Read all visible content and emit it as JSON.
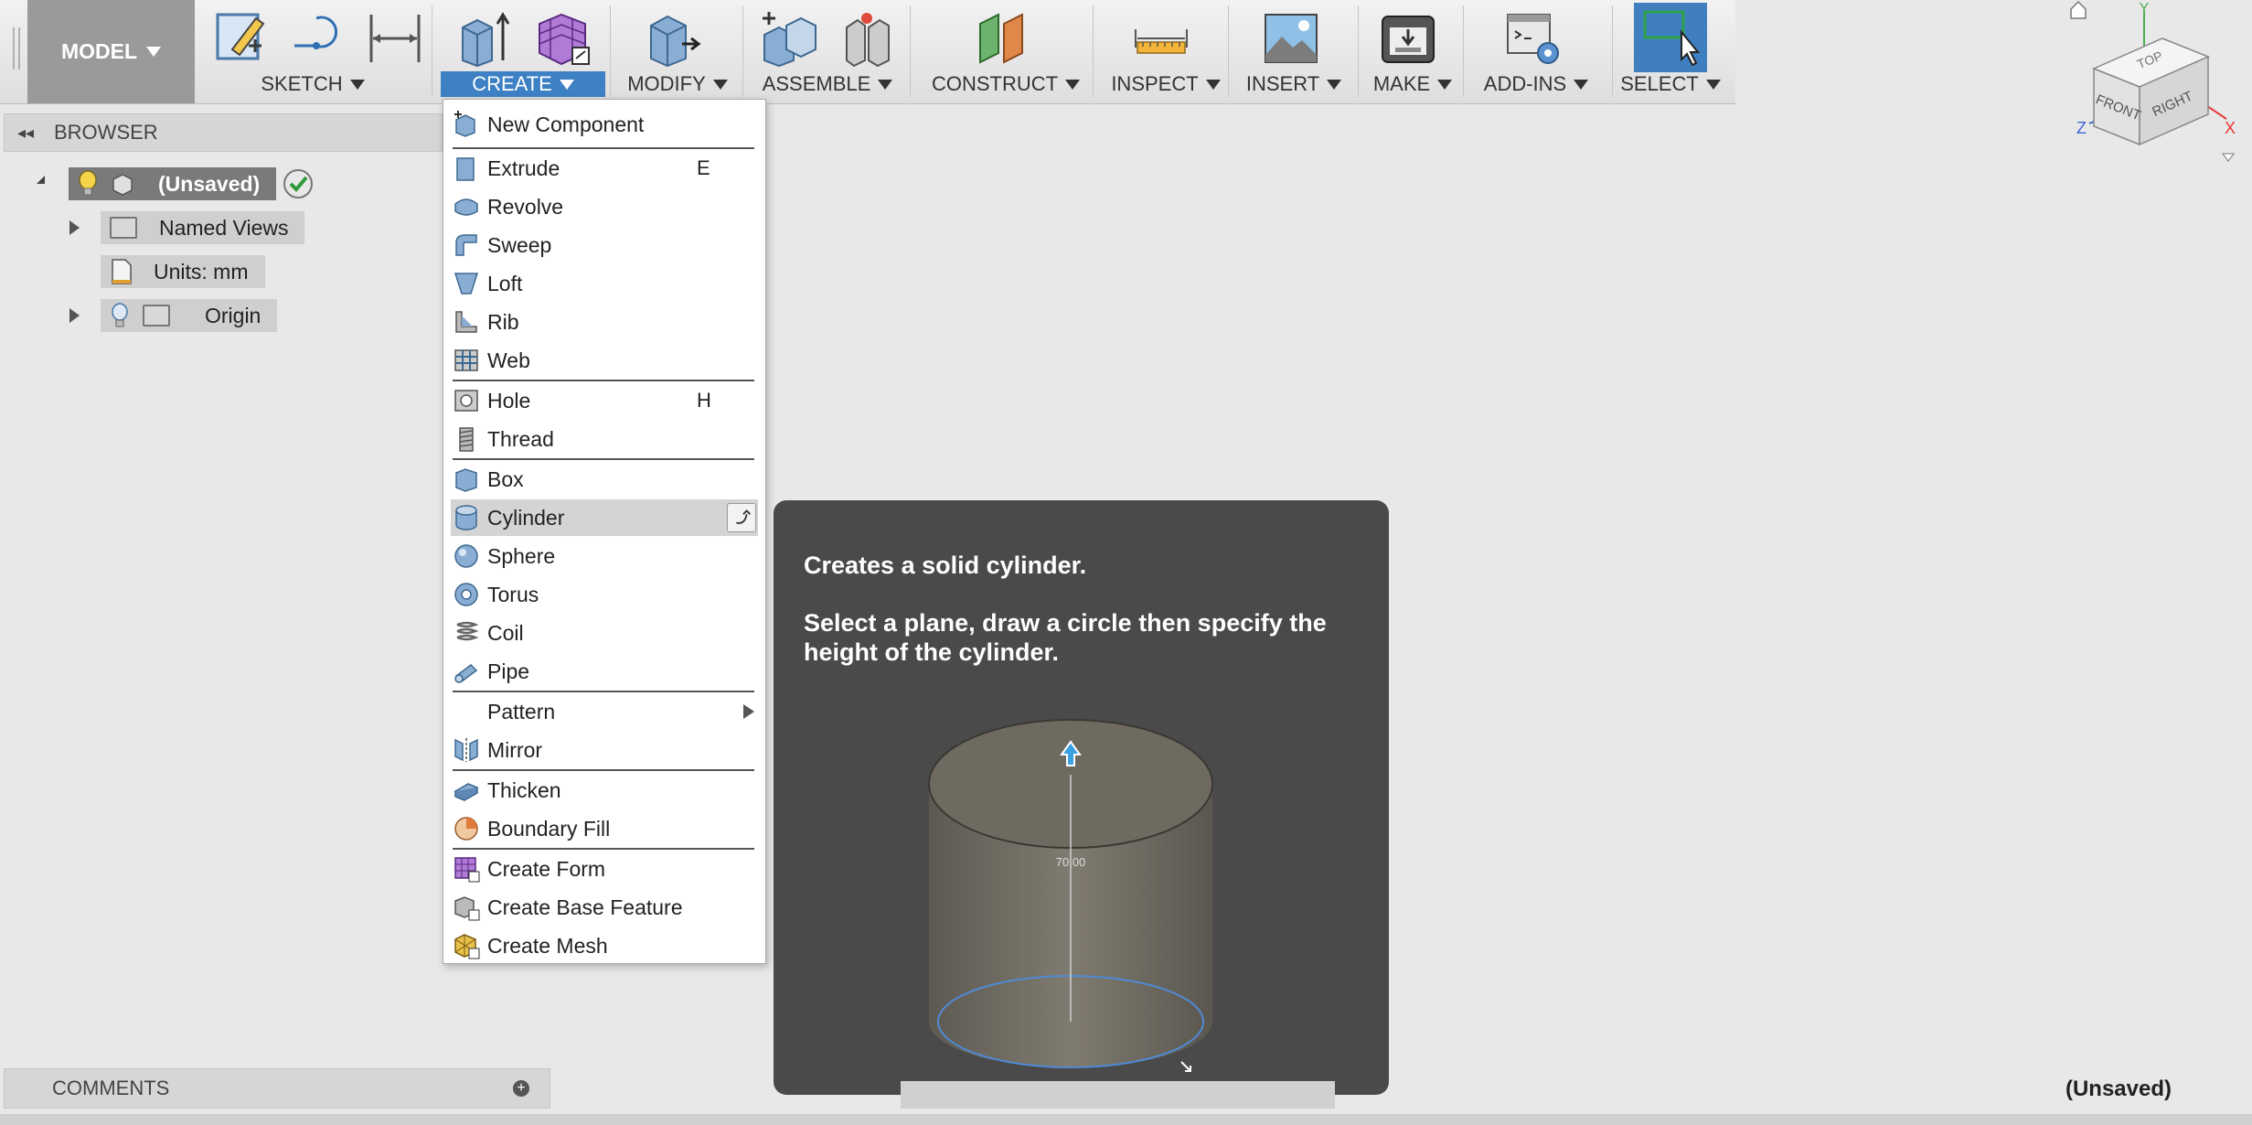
{
  "toolbar": {
    "workspace": "MODEL",
    "groups": [
      {
        "label": "SKETCH"
      },
      {
        "label": "CREATE"
      },
      {
        "label": "MODIFY"
      },
      {
        "label": "ASSEMBLE"
      },
      {
        "label": "CONSTRUCT"
      },
      {
        "label": "INSPECT"
      },
      {
        "label": "INSERT"
      },
      {
        "label": "MAKE"
      },
      {
        "label": "ADD-INS"
      },
      {
        "label": "SELECT"
      }
    ]
  },
  "browser": {
    "title": "BROWSER",
    "root": "(Unsaved)",
    "items": [
      "Named Views",
      "Units: mm",
      "Origin"
    ]
  },
  "create_menu": {
    "items": [
      {
        "label": "New Component",
        "shortcut": ""
      },
      {
        "label": "Extrude",
        "shortcut": "E"
      },
      {
        "label": "Revolve",
        "shortcut": ""
      },
      {
        "label": "Sweep",
        "shortcut": ""
      },
      {
        "label": "Loft",
        "shortcut": ""
      },
      {
        "label": "Rib",
        "shortcut": ""
      },
      {
        "label": "Web",
        "shortcut": ""
      },
      {
        "label": "Hole",
        "shortcut": "H"
      },
      {
        "label": "Thread",
        "shortcut": ""
      },
      {
        "label": "Box",
        "shortcut": ""
      },
      {
        "label": "Cylinder",
        "shortcut": ""
      },
      {
        "label": "Sphere",
        "shortcut": ""
      },
      {
        "label": "Torus",
        "shortcut": ""
      },
      {
        "label": "Coil",
        "shortcut": ""
      },
      {
        "label": "Pipe",
        "shortcut": ""
      },
      {
        "label": "Pattern",
        "shortcut": ""
      },
      {
        "label": "Mirror",
        "shortcut": ""
      },
      {
        "label": "Thicken",
        "shortcut": ""
      },
      {
        "label": "Boundary Fill",
        "shortcut": ""
      },
      {
        "label": "Create Form",
        "shortcut": ""
      },
      {
        "label": "Create Base Feature",
        "shortcut": ""
      },
      {
        "label": "Create Mesh",
        "shortcut": ""
      }
    ]
  },
  "tooltip": {
    "title": "Creates a solid cylinder.",
    "description": "Select a plane, draw a circle then specify the height of the cylinder.",
    "dimension": "70.00"
  },
  "viewcube": {
    "top": "TOP",
    "front": "FRONT",
    "right": "RIGHT",
    "axis_x": "X",
    "axis_y": "Y",
    "axis_z": "Z"
  },
  "comments": {
    "title": "COMMENTS"
  },
  "status": {
    "document": "(Unsaved)"
  },
  "colors": {
    "accent": "#3d80c4",
    "tooltip_bg": "#4a4a4a",
    "menu_highlight": "#d4d4d4"
  }
}
